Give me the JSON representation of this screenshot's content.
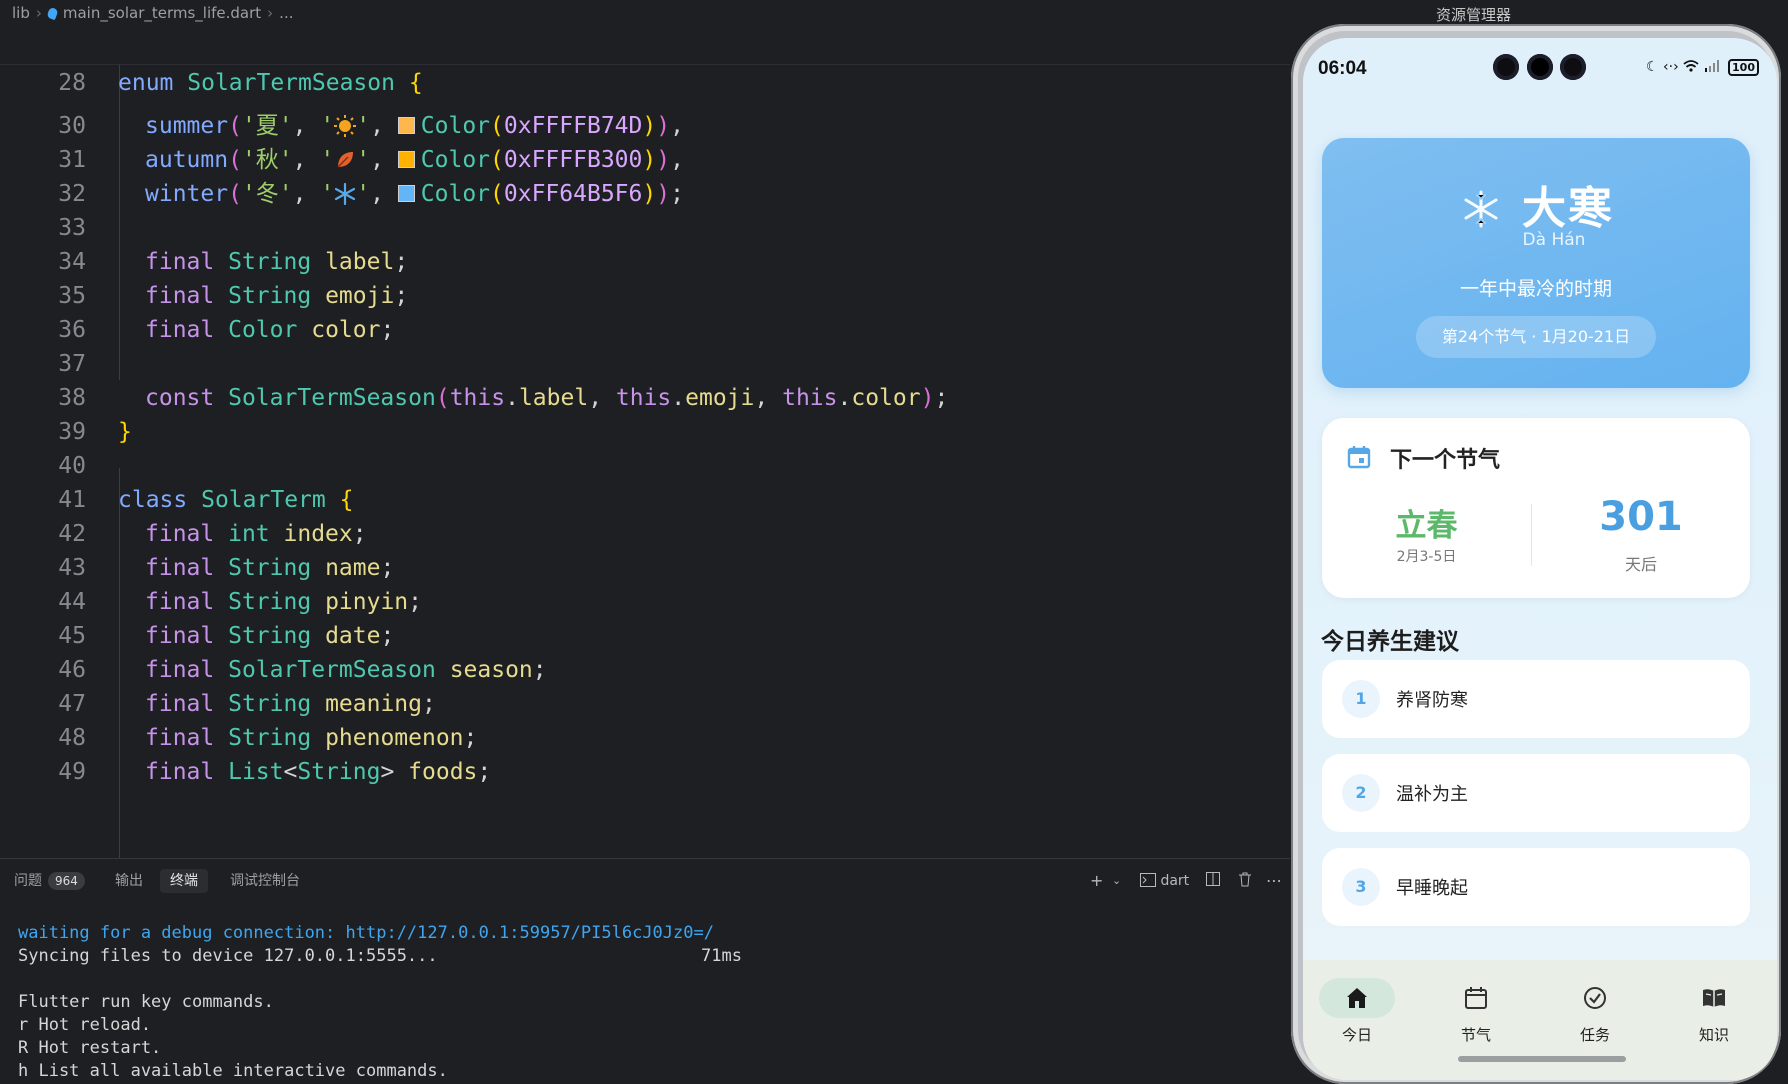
{
  "breadcrumb": [
    "lib",
    "main_solar_terms_life.dart",
    "..."
  ],
  "code": {
    "sticky": {
      "ln": "28"
    },
    "lines": [
      {
        "ln": "30"
      },
      {
        "ln": "31"
      },
      {
        "ln": "32"
      },
      {
        "ln": "33"
      },
      {
        "ln": "34"
      },
      {
        "ln": "35"
      },
      {
        "ln": "36"
      },
      {
        "ln": "37"
      },
      {
        "ln": "38"
      },
      {
        "ln": "39"
      },
      {
        "ln": "40"
      },
      {
        "ln": "41"
      },
      {
        "ln": "42"
      },
      {
        "ln": "43"
      },
      {
        "ln": "44"
      },
      {
        "ln": "45"
      },
      {
        "ln": "46"
      },
      {
        "ln": "47"
      },
      {
        "ln": "48"
      },
      {
        "ln": "49"
      }
    ],
    "swatch_colors": [
      "#FFB74D",
      "#FFB300",
      "#64B5F6"
    ]
  },
  "panel": {
    "tabs": [
      {
        "label": "问题",
        "badge": "964"
      },
      {
        "label": "输出"
      },
      {
        "label": "终端",
        "active": true
      },
      {
        "label": "调试控制台"
      }
    ],
    "shell_label": "dart",
    "terminal": {
      "l1": "waiting for a debug connection: http://127.0.0.1:59957/PI5l6cJ0Jz0=/",
      "l2": "Syncing files to device 127.0.0.1:5555...",
      "l2_time": "71ms",
      "l3": "Flutter run key commands.",
      "l4": "r Hot reload.",
      "l5": "R Hot restart.",
      "l6": "h List all available interactive commands."
    }
  },
  "explorer": {
    "title": "资源管理器"
  },
  "phone": {
    "status": {
      "time": "06:04",
      "battery": "100"
    },
    "hero": {
      "name": "大寒",
      "pinyin": "Dà Hán",
      "meaning": "一年中最冷的时期",
      "pill": "第24个节气 · 1月20-21日",
      "color": "#64B5F6"
    },
    "next": {
      "title": "下一个节气",
      "name": "立春",
      "date": "2月3-5日",
      "days": "301",
      "unit": "天后"
    },
    "advice": {
      "title": "今日养生建议",
      "items": [
        {
          "num": "1",
          "text": "养肾防寒"
        },
        {
          "num": "2",
          "text": "温补为主"
        },
        {
          "num": "3",
          "text": "早睡晚起"
        }
      ]
    },
    "nav": [
      {
        "label": "今日",
        "icon": "home-icon",
        "active": true
      },
      {
        "label": "节气",
        "icon": "calendar-icon"
      },
      {
        "label": "任务",
        "icon": "check-circle-icon"
      },
      {
        "label": "知识",
        "icon": "book-icon"
      }
    ]
  }
}
